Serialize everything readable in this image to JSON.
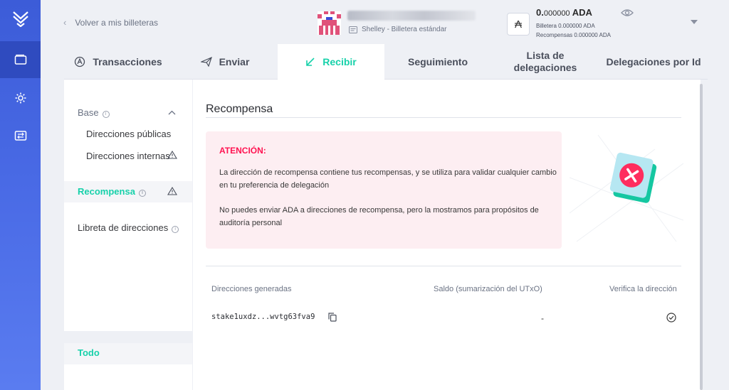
{
  "topbar": {
    "back_label": "Volver a mis billeteras",
    "wallet_type": "Shelley - Billetera estándar",
    "balance_int": "0.",
    "balance_dec": "000000",
    "balance_unit": "ADA",
    "wallet_balance": "Billetera 0.000000 ADA",
    "rewards_balance": "Recompensas 0.000000 ADA"
  },
  "tabs": [
    {
      "label": "Transacciones"
    },
    {
      "label": "Enviar"
    },
    {
      "label": "Recibir"
    },
    {
      "label": "Seguimiento"
    },
    {
      "label": "Lista de delegaciones"
    },
    {
      "label": "Delegaciones por Id"
    }
  ],
  "subnav": {
    "base": "Base",
    "public": "Direcciones públicas",
    "internal": "Direcciones internas",
    "reward": "Recompensa",
    "address_book": "Libreta de direcciones",
    "all": "Todo"
  },
  "main": {
    "title": "Recompensa",
    "notice_title": "ATENCIÓN:",
    "notice_p1": "La dirección de recompensa contiene tus recompensas, y se utiliza para validar cualquier cambio en tu preferencia de delegación",
    "notice_p2": "No puedes enviar ADA a direcciones de recompensa, pero la mostramos para propósitos de auditoría personal",
    "col_addresses": "Direcciones generadas",
    "col_balance": "Saldo (sumarización del UTxO)",
    "col_verify": "Verifica la dirección",
    "rows": [
      {
        "address": "stake1uxdz...wvtg63fva9",
        "balance": "-"
      }
    ]
  },
  "colors": {
    "accent": "#17d1aa",
    "nav": "#3c5cd8",
    "warning": "#ff1351"
  }
}
